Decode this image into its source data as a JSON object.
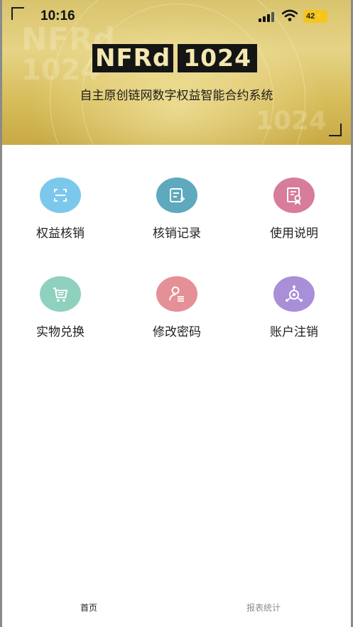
{
  "status_bar": {
    "time": "10:16",
    "battery": "42",
    "icons": [
      "cellular-signal-icon",
      "wifi-icon",
      "battery-charging-icon"
    ]
  },
  "banner": {
    "logo_text": "NFRd",
    "logo_number": "1024",
    "subtitle": "自主原创链网数字权益智能合约系统",
    "background_color": "#d9c46e"
  },
  "menu": {
    "items": [
      {
        "label": "权益核销",
        "icon": "scan-icon",
        "color": "#7cc8ec"
      },
      {
        "label": "核销记录",
        "icon": "record-add-icon",
        "color": "#5ea9be"
      },
      {
        "label": "使用说明",
        "icon": "certificate-icon",
        "color": "#d77c9b"
      },
      {
        "label": "实物兑换",
        "icon": "cart-icon",
        "color": "#8ed1be"
      },
      {
        "label": "修改密码",
        "icon": "user-edit-icon",
        "color": "#e59096"
      },
      {
        "label": "账户注销",
        "icon": "account-cancel-icon",
        "color": "#a98ed8"
      }
    ]
  },
  "tabbar": {
    "home_label": "首页",
    "stats_label": "报表统计",
    "active_color": "#222222",
    "inactive_color": "#8c8c8c"
  }
}
